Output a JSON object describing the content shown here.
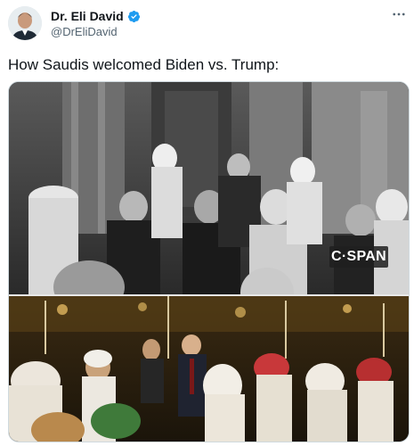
{
  "author": {
    "display_name": "Dr. Eli David",
    "handle": "@DrEliDavid",
    "verified": true,
    "avatar_icon": "avatar-photo"
  },
  "tweet": {
    "text": "How Saudis welcomed Biden vs. Trump:"
  },
  "media": {
    "top_watermark": "C·SPAN",
    "top_description": "photo-grayscale-crowd",
    "bottom_description": "photo-color-ceremony"
  },
  "icons": {
    "more": "more-horizontal-icon",
    "verified": "verified-badge-icon"
  },
  "colors": {
    "text_primary": "#0f1419",
    "text_secondary": "#536471",
    "verified_blue": "#1d9bf0"
  }
}
